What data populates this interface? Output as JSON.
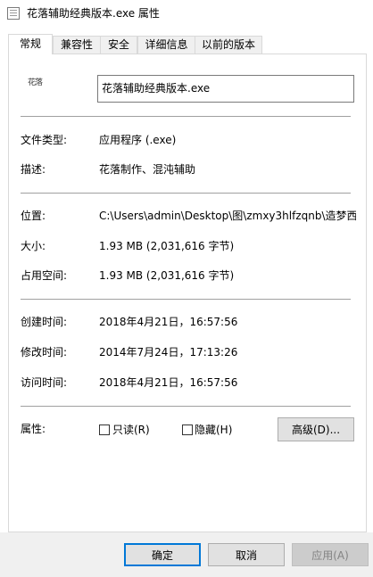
{
  "window": {
    "title": "花落辅助经典版本.exe 属性"
  },
  "tabs": [
    {
      "label": "常规",
      "active": true
    },
    {
      "label": "兼容性",
      "active": false
    },
    {
      "label": "安全",
      "active": false
    },
    {
      "label": "详细信息",
      "active": false
    },
    {
      "label": "以前的版本",
      "active": false
    }
  ],
  "general": {
    "file_icon_text": "花落",
    "file_name": "花落辅助经典版本.exe",
    "file_type_label": "文件类型:",
    "file_type_value": "应用程序 (.exe)",
    "description_label": "描述:",
    "description_value": "花落制作、混沌辅助",
    "location_label": "位置:",
    "location_value": "C:\\Users\\admin\\Desktop\\图\\zmxy3hlfzqnb\\造梦西",
    "size_label": "大小:",
    "size_value": "1.93 MB (2,031,616 字节)",
    "size_on_disk_label": "占用空间:",
    "size_on_disk_value": "1.93 MB (2,031,616 字节)",
    "created_label": "创建时间:",
    "created_value": "2018年4月21日，16:57:56",
    "modified_label": "修改时间:",
    "modified_value": "2014年7月24日，17:13:26",
    "accessed_label": "访问时间:",
    "accessed_value": "2018年4月21日，16:57:56",
    "attributes_label": "属性:",
    "readonly_label": "只读(R)",
    "readonly_checked": false,
    "hidden_label": "隐藏(H)",
    "hidden_checked": false,
    "advanced_button": "高级(D)..."
  },
  "footer": {
    "ok": "确定",
    "cancel": "取消",
    "apply": "应用(A)"
  },
  "colors": {
    "default_button_border": "#0078d7",
    "footer_background": "#f0f0f0",
    "disabled_text": "#838383"
  }
}
